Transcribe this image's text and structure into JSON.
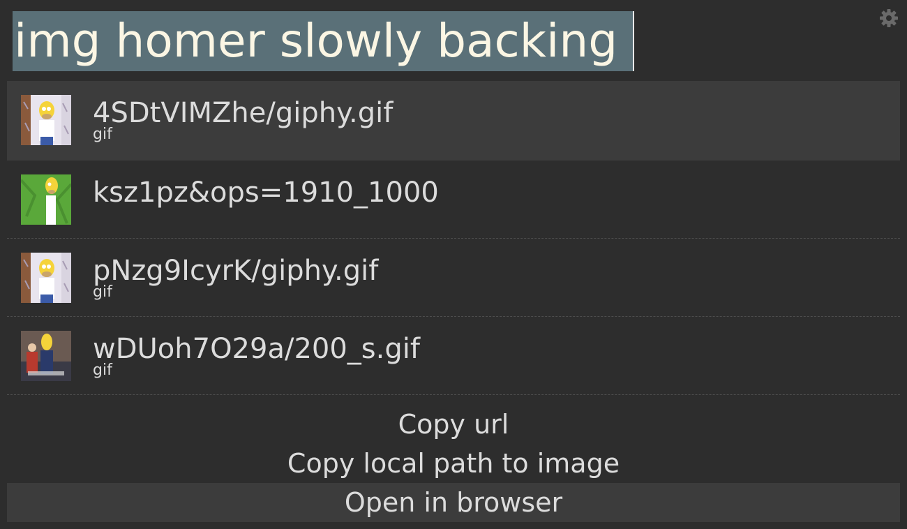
{
  "search": {
    "query": "img homer slowly backing"
  },
  "results": [
    {
      "title": "4SDtVIMZhe/giphy.gif",
      "subtitle": "gif",
      "selected": true
    },
    {
      "title": "ksz1pz&ops=1910_1000",
      "subtitle": "",
      "selected": false
    },
    {
      "title": "pNzg9IcyrK/giphy.gif",
      "subtitle": "gif",
      "selected": false
    },
    {
      "title": "wDUoh7O29a/200_s.gif",
      "subtitle": "gif",
      "selected": false
    }
  ],
  "actions": [
    {
      "label": "Copy url",
      "selected": false
    },
    {
      "label": "Copy local path to image",
      "selected": false
    },
    {
      "label": "Open in browser",
      "selected": true
    }
  ],
  "icons": {
    "settings": "gear-icon"
  },
  "colors": {
    "background": "#2d2d2d",
    "selection": "#3c3c3c",
    "query_highlight": "#5a7078",
    "text": "#dcdcdc"
  }
}
